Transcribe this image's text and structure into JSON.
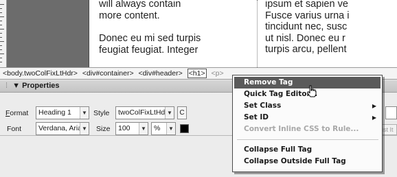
{
  "design_view": {
    "left_column_lines": [
      "will always contain",
      "more content.",
      "Donec eu mi sed turpis",
      "feugiat feugiat. Integer"
    ],
    "right_column_lines": [
      "ipsum et sapien ve",
      "Fusce varius urna i",
      "tincidunt nec, susc",
      "ut nisl. Donec eu r",
      "turpis arcu, pellent"
    ]
  },
  "tag_selector": {
    "tags": [
      "<body.twoColFixLtHdr>",
      "<div#container>",
      "<div#header>",
      "<h1>"
    ],
    "faded": "<p>"
  },
  "properties": {
    "title": "Properties",
    "format_label": "Format",
    "format_value": "Heading 1",
    "style_label": "Style",
    "style_value": "twoColFixLtHdr",
    "css_button": "C",
    "font_label": "Font",
    "font_value": "Verdana, Arial",
    "size_label": "Size",
    "size_value": "100",
    "unit_value": "%",
    "text_color": "#000000",
    "list_item_label": "ist It"
  },
  "context_menu": {
    "items": [
      {
        "label": "Remove Tag",
        "state": "highlighted"
      },
      {
        "label": "Quick Tag Editor...",
        "state": "normal"
      },
      {
        "label": "Set Class",
        "state": "normal",
        "submenu": true
      },
      {
        "label": "Set ID",
        "state": "normal",
        "submenu": true
      },
      {
        "label": "Convert Inline CSS to Rule...",
        "state": "disabled"
      },
      {
        "label": "Collapse Full Tag",
        "state": "normal"
      },
      {
        "label": "Collapse Outside Full Tag",
        "state": "normal"
      }
    ]
  },
  "colors": {
    "highlight": "#5a5a5a",
    "sidebar_block": "#6c6c6c",
    "panel": "#ececec"
  },
  "icons": {
    "dropdown": "chevron-down-icon",
    "submenu": "chevron-right-icon",
    "collapse": "triangle-down-icon",
    "cursor": "hand-pointer-icon"
  }
}
